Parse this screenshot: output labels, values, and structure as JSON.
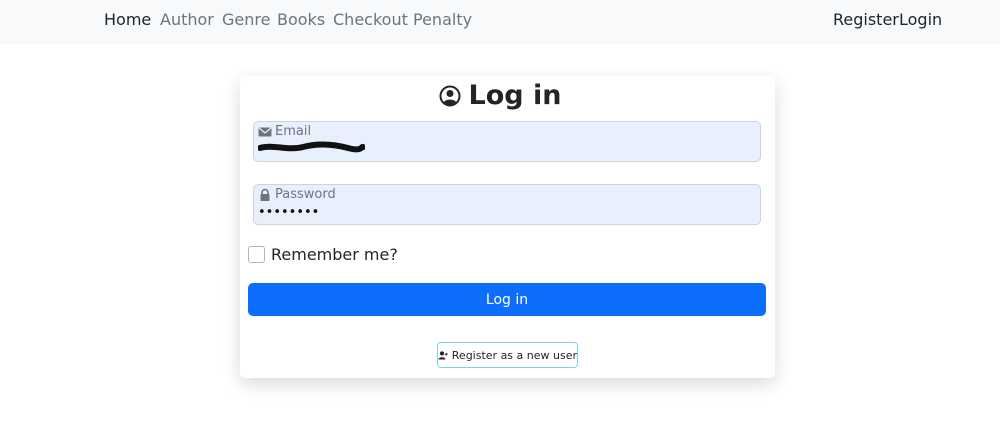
{
  "nav": {
    "links": [
      "Home",
      "Author",
      "Genre",
      "Books",
      "Checkout",
      "Penalty"
    ],
    "register": "Register",
    "login": "Login"
  },
  "form": {
    "title": "Log in",
    "email_label": "Email",
    "password_label": "Password",
    "password_value": "••••••••",
    "remember_label": "Remember me?",
    "remember_checked": false,
    "submit_label": "Log in",
    "register_label": "Register as a new user"
  },
  "icons": {
    "title": "user-circle-icon",
    "email": "envelope-icon",
    "password": "lock-icon",
    "register": "user-plus-icon"
  },
  "colors": {
    "primary": "#0d6efd",
    "field_bg": "#e8f0fe",
    "nav_bg": "#f8f9fa",
    "register_border": "#7fd4e6"
  }
}
